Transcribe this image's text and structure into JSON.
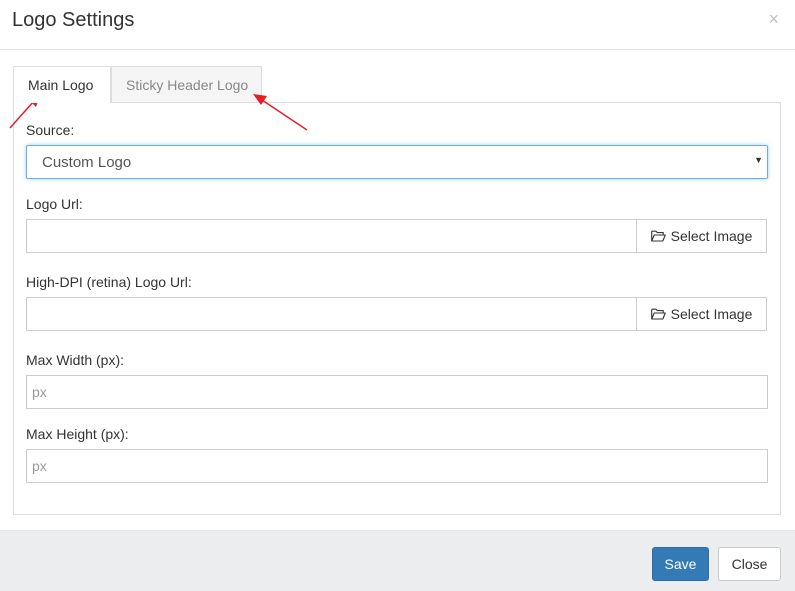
{
  "modal": {
    "title": "Logo Settings",
    "close_glyph": "×"
  },
  "tabs": [
    {
      "label": "Main Logo",
      "active": true
    },
    {
      "label": "Sticky Header Logo",
      "active": false
    }
  ],
  "form": {
    "source": {
      "label": "Source:",
      "value": "Custom Logo",
      "arrow": "▼"
    },
    "logo_url": {
      "label": "Logo Url:",
      "value": "",
      "button_label": "Select Image",
      "button_icon": "folder-open-icon"
    },
    "retina_logo_url": {
      "label": "High-DPI (retina) Logo Url:",
      "value": "",
      "button_label": "Select Image",
      "button_icon": "folder-open-icon"
    },
    "max_width": {
      "label": "Max Width (px):",
      "placeholder": "px",
      "value": ""
    },
    "max_height": {
      "label": "Max Height (px):",
      "placeholder": "px",
      "value": ""
    }
  },
  "footer": {
    "save_label": "Save",
    "close_label": "Close"
  },
  "colors": {
    "primary": "#337ab7",
    "focus_border": "#66afe9",
    "annotation_arrow": "#e31e24",
    "footer_bg": "#ebedef"
  }
}
